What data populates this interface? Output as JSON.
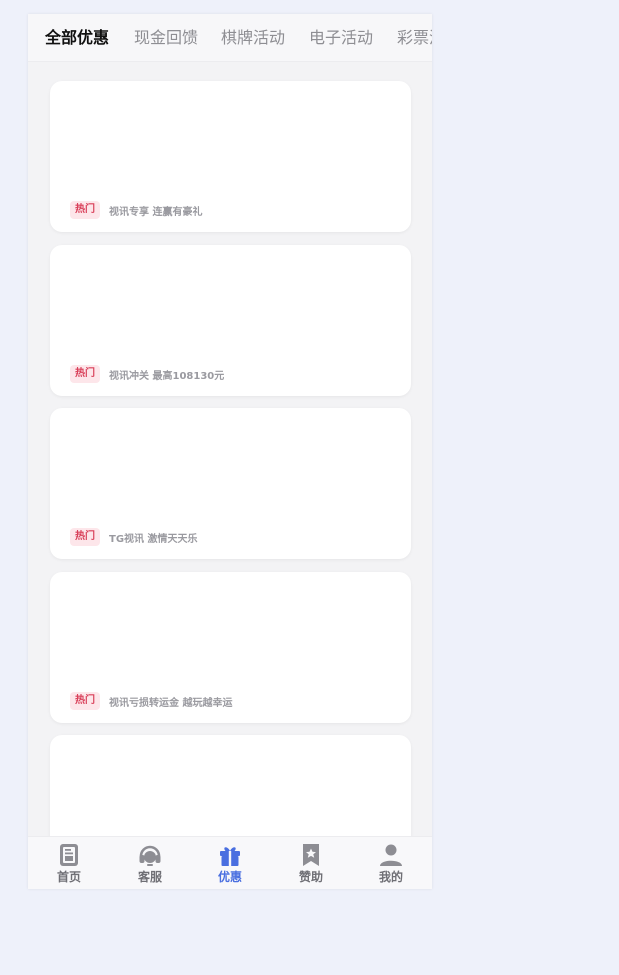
{
  "tabs": [
    {
      "label": "全部优惠",
      "active": true
    },
    {
      "label": "现金回馈",
      "active": false
    },
    {
      "label": "棋牌活动",
      "active": false
    },
    {
      "label": "电子活动",
      "active": false
    },
    {
      "label": "彩票活动",
      "active": false
    }
  ],
  "cards": [
    {
      "badge": "热门",
      "title": "视讯专享 连赢有豪礼"
    },
    {
      "badge": "热门",
      "title": "视讯冲关 最高108130元"
    },
    {
      "badge": "热门",
      "title": "TG视讯 激情天天乐"
    },
    {
      "badge": "热门",
      "title": "视讯亏损转运金 越玩越幸运"
    },
    {
      "badge": "",
      "title": ""
    }
  ],
  "nav": {
    "items": [
      {
        "label": "首页",
        "icon": "home-icon"
      },
      {
        "label": "客服",
        "icon": "headset-icon"
      },
      {
        "label": "优惠",
        "icon": "gift-icon"
      },
      {
        "label": "赞助",
        "icon": "bookmark-star-icon"
      },
      {
        "label": "我的",
        "icon": "user-icon"
      }
    ],
    "active_index": 2
  },
  "colors": {
    "accent": "#4a6fe0",
    "badge_bg": "#fde6ea",
    "badge_text": "#d9405a",
    "page_bg": "#eef1fa"
  }
}
